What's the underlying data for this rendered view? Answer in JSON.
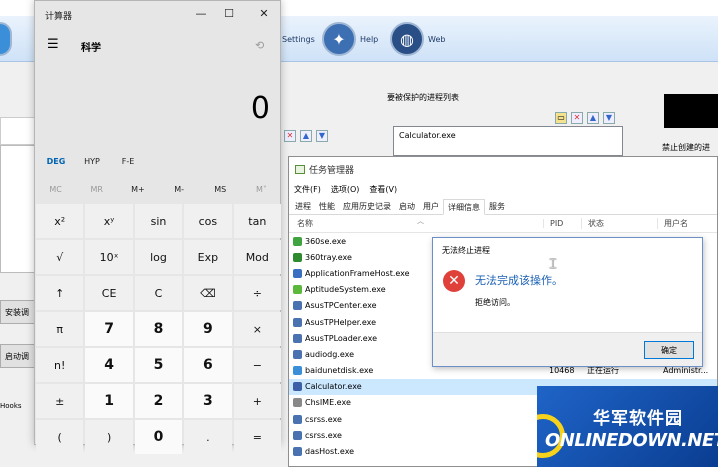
{
  "bg": {
    "toolbar": [
      {
        "label": "Settings",
        "icon": "gear-icon"
      },
      {
        "label": "Help",
        "icon": "compass-icon"
      },
      {
        "label": "Web",
        "icon": "globe-icon"
      }
    ],
    "side_buttons": [
      "安装调",
      "启动调"
    ],
    "hooks_label": "Hooks",
    "protect_title": "要被保护的进程列表",
    "protect_item": "Calculator.exe",
    "right_label": "禁止创建的进"
  },
  "taskmgr": {
    "title": "任务管理器",
    "menu": [
      "文件(F)",
      "选项(O)",
      "查看(V)"
    ],
    "tabs": [
      "进程",
      "性能",
      "应用历史记录",
      "启动",
      "用户",
      "详细信息",
      "服务"
    ],
    "active_tab": 5,
    "columns": {
      "name": "名称",
      "pid": "PID",
      "status": "状态",
      "user": "用户名"
    },
    "rows": [
      {
        "name": "360se.exe",
        "pid": "",
        "status": "",
        "user": "",
        "color": "#3fa33f"
      },
      {
        "name": "360tray.exe",
        "pid": "",
        "status": "",
        "user": "",
        "color": "#2f8a2f"
      },
      {
        "name": "ApplicationFrameHost.exe",
        "pid": "",
        "status": "",
        "user": "",
        "color": "#3a6fc1"
      },
      {
        "name": "AptitudeSystem.exe",
        "pid": "",
        "status": "",
        "user": "",
        "color": "#5cb83a"
      },
      {
        "name": "AsusTPCenter.exe",
        "pid": "",
        "status": "",
        "user": "",
        "color": "#4a72b0"
      },
      {
        "name": "AsusTPHelper.exe",
        "pid": "",
        "status": "",
        "user": "",
        "color": "#4a72b0"
      },
      {
        "name": "AsusTPLoader.exe",
        "pid": "",
        "status": "",
        "user": "",
        "color": "#4a72b0"
      },
      {
        "name": "audiodg.exe",
        "pid": "",
        "status": "",
        "user": "",
        "color": "#4a72b0"
      },
      {
        "name": "baidunetdisk.exe",
        "pid": "10468",
        "status": "正在运行",
        "user": "Administr...",
        "color": "#3a8fd8"
      },
      {
        "name": "Calculator.exe",
        "pid": "",
        "status": "",
        "user": "",
        "color": "#3d5fa8",
        "selected": true
      },
      {
        "name": "ChsIME.exe",
        "pid": "",
        "status": "",
        "user": "",
        "color": "#888888"
      },
      {
        "name": "csrss.exe",
        "pid": "",
        "status": "",
        "user": "",
        "color": "#4a72b0"
      },
      {
        "name": "csrss.exe",
        "pid": "",
        "status": "",
        "user": "",
        "color": "#4a72b0"
      },
      {
        "name": "dasHost.exe",
        "pid": "",
        "status": "",
        "user": "",
        "color": "#4a72b0"
      }
    ]
  },
  "error": {
    "title": "无法终止进程",
    "message": "无法完成该操作。",
    "detail": "拒绝访问。",
    "ok": "确定"
  },
  "calc": {
    "title": "计算器",
    "mode": "科学",
    "display": "0",
    "toggles": [
      "DEG",
      "HYP",
      "F-E"
    ],
    "memory": [
      "MC",
      "MR",
      "M+",
      "M-",
      "MS",
      "M˅"
    ],
    "buttons": [
      "x²",
      "xʸ",
      "sin",
      "cos",
      "tan",
      "√",
      "10ˣ",
      "log",
      "Exp",
      "Mod",
      "↑",
      "CE",
      "C",
      "⌫",
      "÷",
      "π",
      "7",
      "8",
      "9",
      "×",
      "n!",
      "4",
      "5",
      "6",
      "−",
      "±",
      "1",
      "2",
      "3",
      "+",
      "(",
      ")",
      "0",
      ".",
      "="
    ]
  },
  "watermark": {
    "cn": "华军软件园",
    "en": "ONLINEDOWN.NET"
  }
}
